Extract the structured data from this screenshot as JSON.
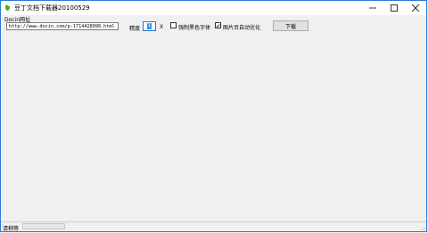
{
  "window": {
    "title": "豆丁文档下载器20100529"
  },
  "form": {
    "url_label": "Docin网址",
    "url_value": "http://www.docin.com/p-1714428990.html",
    "precision_label": "精度",
    "precision_value": "1",
    "precision_unit": "X",
    "force_black_font_label": "强制黑色字体",
    "force_black_font_checked": false,
    "auto_optimize_label": "图片页自动优化",
    "auto_optimize_checked": true,
    "download_button": "下载"
  },
  "status": {
    "text": "请稍等",
    "progress": 0
  },
  "colors": {
    "accent": "#1e78d7",
    "selection": "#3390ff",
    "window_bg": "#f0f0f0"
  }
}
